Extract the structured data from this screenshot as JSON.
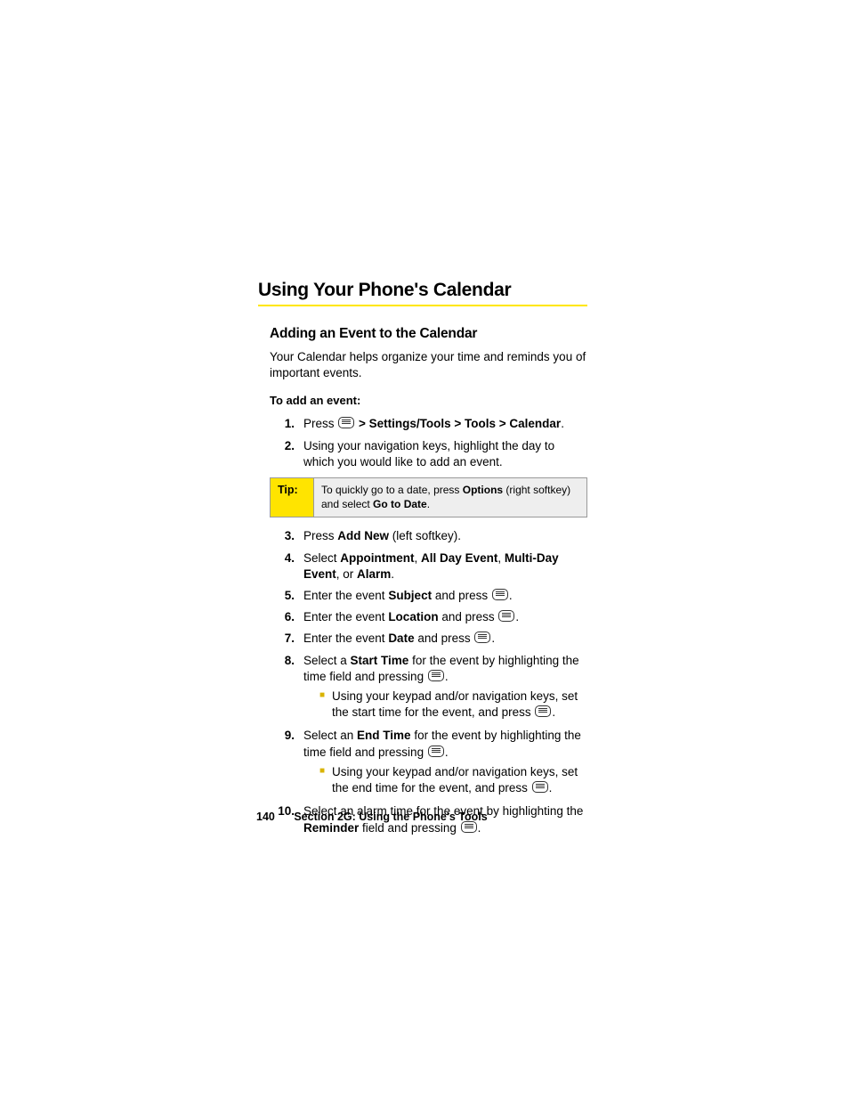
{
  "heading": "Using Your Phone's Calendar",
  "subheading": "Adding an Event to the Calendar",
  "intro": "Your Calendar helps organize your time and reminds you of important events.",
  "lead": "To add an event:",
  "steps": {
    "s1": {
      "num": "1.",
      "prefix": "Press ",
      "path": " > Settings/Tools > Tools > Calendar",
      "suffix": "."
    },
    "s2": {
      "num": "2.",
      "text": "Using your navigation keys, highlight the day to which you would like to add an event."
    },
    "tip": {
      "label": "Tip:",
      "pre": "To quickly go to a date, press ",
      "b1": "Options",
      "mid": " (right softkey) and select ",
      "b2": "Go to Date",
      "post": "."
    },
    "s3": {
      "num": "3.",
      "pre": "Press ",
      "b1": "Add New",
      "post": " (left softkey)."
    },
    "s4": {
      "num": "4.",
      "pre": "Select ",
      "b1": "Appointment",
      "c1": ", ",
      "b2": "All Day Event",
      "c2": ", ",
      "b3": "Multi-Day Event",
      "c3": ", or ",
      "b4": "Alarm",
      "post": "."
    },
    "s5": {
      "num": "5.",
      "pre": "Enter the event ",
      "b1": "Subject",
      "mid": " and press ",
      "post": "."
    },
    "s6": {
      "num": "6.",
      "pre": "Enter the event ",
      "b1": "Location",
      "mid": " and press ",
      "post": "."
    },
    "s7": {
      "num": "7.",
      "pre": "Enter the event ",
      "b1": "Date",
      "mid": " and press ",
      "post": "."
    },
    "s8": {
      "num": "8.",
      "pre": "Select a ",
      "b1": "Start Time",
      "mid": " for the event by highlighting the time field and pressing ",
      "post": ".",
      "sub": {
        "pre": "Using your keypad and/or navigation keys, set the start time for the event, and press ",
        "post": "."
      }
    },
    "s9": {
      "num": "9.",
      "pre": "Select an ",
      "b1": "End Time",
      "mid": " for the event by highlighting the time field and pressing ",
      "post": ".",
      "sub": {
        "pre": "Using your keypad and/or navigation keys, set the end time for the event, and press ",
        "post": "."
      }
    },
    "s10": {
      "num": "10.",
      "pre": "Select an alarm time for the event by highlighting the ",
      "b1": "Reminder",
      "mid": " field and pressing ",
      "post": "."
    }
  },
  "footer": {
    "page": "140",
    "section": "Section 2G: Using the Phone's Tools"
  }
}
